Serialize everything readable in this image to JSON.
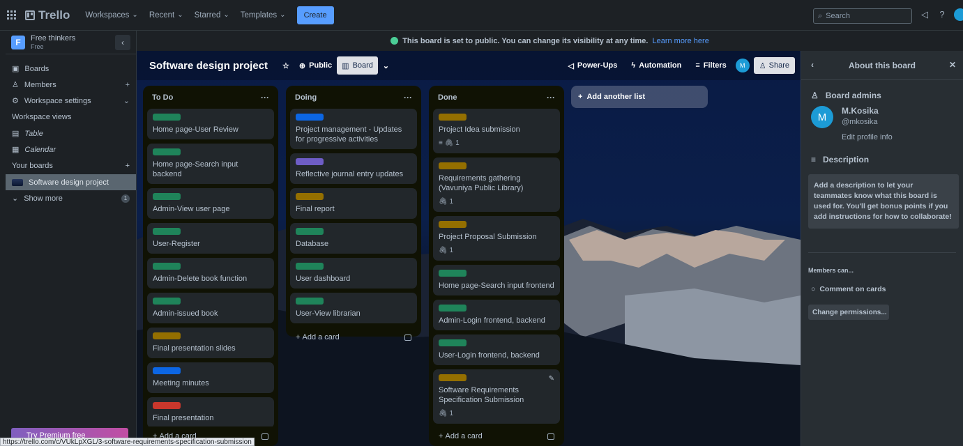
{
  "topbar": {
    "logo": "Trello",
    "nav": [
      "Workspaces",
      "Recent",
      "Starred",
      "Templates"
    ],
    "create": "Create",
    "search_placeholder": "Search"
  },
  "sidebar": {
    "workspace_initial": "F",
    "workspace_name": "Free thinkers",
    "workspace_plan": "Free",
    "items": [
      {
        "label": "Boards",
        "icon": "boards-icon"
      },
      {
        "label": "Members",
        "icon": "members-icon",
        "right": "+"
      },
      {
        "label": "Workspace settings",
        "icon": "settings-icon",
        "right": "⌄"
      }
    ],
    "views_title": "Workspace views",
    "views": [
      "Table",
      "Calendar"
    ],
    "your_boards_title": "Your boards",
    "your_boards_add": "+",
    "boards": [
      "Software design project"
    ],
    "show_more": "Show more",
    "show_more_count": "1",
    "premium": "Try Premium free"
  },
  "banner": {
    "text": "This board is set to public. You can change its visibility at any time.",
    "link": "Learn more here"
  },
  "board": {
    "title": "Software design project",
    "visibility": "Public",
    "view": "Board",
    "powerups": "Power-Ups",
    "automation": "Automation",
    "filters": "Filters",
    "member_initial": "M",
    "share": "Share"
  },
  "lists": [
    {
      "title": "To Do",
      "add_card": "Add a card",
      "cards": [
        {
          "label_color": "#1f845a",
          "title": "Home page-User Review"
        },
        {
          "label_color": "#1f845a",
          "title": "Home page-Search input backend"
        },
        {
          "label_color": "#1f845a",
          "title": "Admin-View user page"
        },
        {
          "label_color": "#1f845a",
          "title": "User-Register"
        },
        {
          "label_color": "#1f845a",
          "title": "Admin-Delete book function"
        },
        {
          "label_color": "#1f845a",
          "title": "Admin-issued book"
        },
        {
          "label_color": "#946f00",
          "title": "Final presentation slides"
        },
        {
          "label_color": "#0c66e4",
          "title": "Meeting minutes"
        },
        {
          "label_color": "#c9372c",
          "title": "Final presentation"
        },
        {
          "label_color": "#1f845a",
          "title": ""
        }
      ]
    },
    {
      "title": "Doing",
      "add_card": "Add a card",
      "cards": [
        {
          "label_color": "#0c66e4",
          "title": "Project management - Updates for progressive activities"
        },
        {
          "label_color": "#6e5dc6",
          "title": "Reflective journal entry updates"
        },
        {
          "label_color": "#946f00",
          "title": "Final report"
        },
        {
          "label_color": "#1f845a",
          "title": "Database"
        },
        {
          "label_color": "#1f845a",
          "title": "User dashboard"
        },
        {
          "label_color": "#1f845a",
          "title": "User-View librarian"
        }
      ]
    },
    {
      "title": "Done",
      "add_card": "Add a card",
      "cards": [
        {
          "label_color": "#946f00",
          "title": "Project Idea submission",
          "badges": "≡  🖇 1"
        },
        {
          "label_color": "#946f00",
          "title": "Requirements gathering (Vavuniya Public Library)",
          "badges": "🖇 1"
        },
        {
          "label_color": "#946f00",
          "title": "Project Proposal Submission",
          "badges": "🖇 1"
        },
        {
          "label_color": "#1f845a",
          "title": "Home page-Search input frontend"
        },
        {
          "label_color": "#1f845a",
          "title": "Admin-Login frontend, backend"
        },
        {
          "label_color": "#1f845a",
          "title": "User-Login frontend, backend"
        },
        {
          "label_color": "#946f00",
          "title": "Software Requirements Specification Submission",
          "badges": "🖇 1"
        },
        {
          "label_color": "#1f845a",
          "title": ""
        }
      ]
    }
  ],
  "add_list": "Add another list",
  "panel": {
    "title": "About this board",
    "admins_title": "Board admins",
    "admin_initial": "M",
    "admin_name": "M.Kosika",
    "admin_handle": "@mkosika",
    "edit_profile": "Edit profile info",
    "description_title": "Description",
    "description_placeholder": "Add a description to let your teammates know what this board is used for. You'll get bonus points if you add instructions for how to collaborate!",
    "members_can": "Members can...",
    "comment_on_cards": "Comment on cards",
    "change_permissions": "Change permissions..."
  },
  "status_url": "https://trello.com/c/VUkLpXGL/3-software-requirements-specification-submission"
}
